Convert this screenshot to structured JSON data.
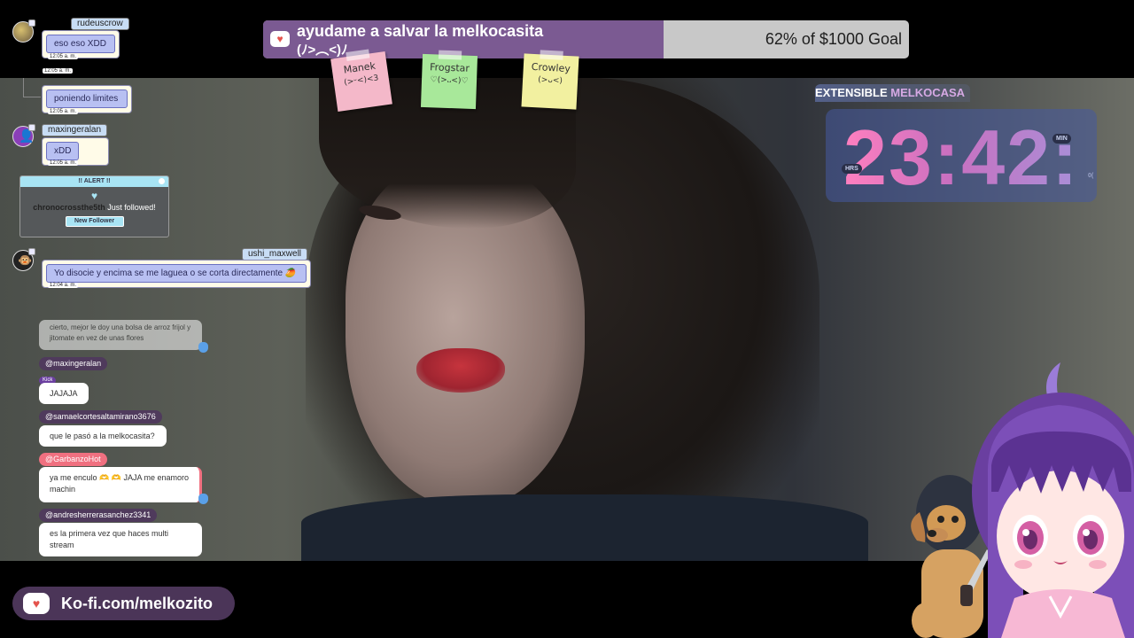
{
  "goal": {
    "title": "ayudame a salvar la melkocasita",
    "subtitle": "(ﾉ>︵<)ﾉ",
    "progress_text": "62% of $1000 Goal",
    "progress": 0.62,
    "icon": "kofi-cup-icon"
  },
  "notes": [
    {
      "name": "Manek",
      "face": "(>ᵕ<)<3",
      "color": "#f4b8c9"
    },
    {
      "name": "Frogstar",
      "face": "♡(>᎑<)♡",
      "color": "#a8e89a"
    },
    {
      "name": "Crowley",
      "face": "(>ᴗ<)",
      "color": "#f2f0a0"
    }
  ],
  "timer": {
    "title_plain": "EXTENSIBLE",
    "title_accent": "MELKOCASA",
    "display": "23:42:",
    "label_hrs": "HRS",
    "label_min": "MIN",
    "label_sec": "0("
  },
  "chat_top": [
    {
      "user": "rudeuscrow",
      "message": "eso eso XDD",
      "time": "12:05 a. m."
    },
    {
      "user": "",
      "message": "poniendo limites",
      "time": "12:05 a. m.",
      "extra_time": "12:05 a. m."
    },
    {
      "user": "maxingeralan",
      "message": "xDD",
      "time": "12:05 a. m."
    },
    {
      "user": "ushi_maxwell",
      "message": "Yo disocie y encima se me laguea o se corta directamente",
      "emoji": "🥭",
      "time": "12:04 a. m."
    }
  ],
  "alert": {
    "header": "!! ALERT !!",
    "user": "chronocrossthe5th",
    "action": "Just followed!",
    "button": "New Follower"
  },
  "chat_lower": [
    {
      "user": "",
      "message": "cierto, mejor le doy una bolsa de arroz frijol y jitomate en vez de unas flores",
      "faded": true
    },
    {
      "user": "@maxingeralan",
      "message": "JAJAJA",
      "badge": "Kick"
    },
    {
      "user": "@samaelcortesaltamirano3676",
      "message": "que le pasó a la melkocasita?"
    },
    {
      "user": "@GarbanzoHot",
      "message": "ya me enculo 🫶 🫶 JAJA me enamoro machin",
      "accent": "#f07080"
    },
    {
      "user": "@andresherrerasanchez3341",
      "message": "es la primera vez que haces multi stream"
    }
  ],
  "kofi": {
    "link_text": "Ko-fi.com/melkozito",
    "icon": "kofi-cup-icon"
  },
  "colors": {
    "goal_fill": "#7b5a92",
    "goal_track": "#c8c8c8",
    "kofi_pill": "#4b3558",
    "alert_accent": "#a8e4f4",
    "timer_accent": "#ff7fbf"
  }
}
